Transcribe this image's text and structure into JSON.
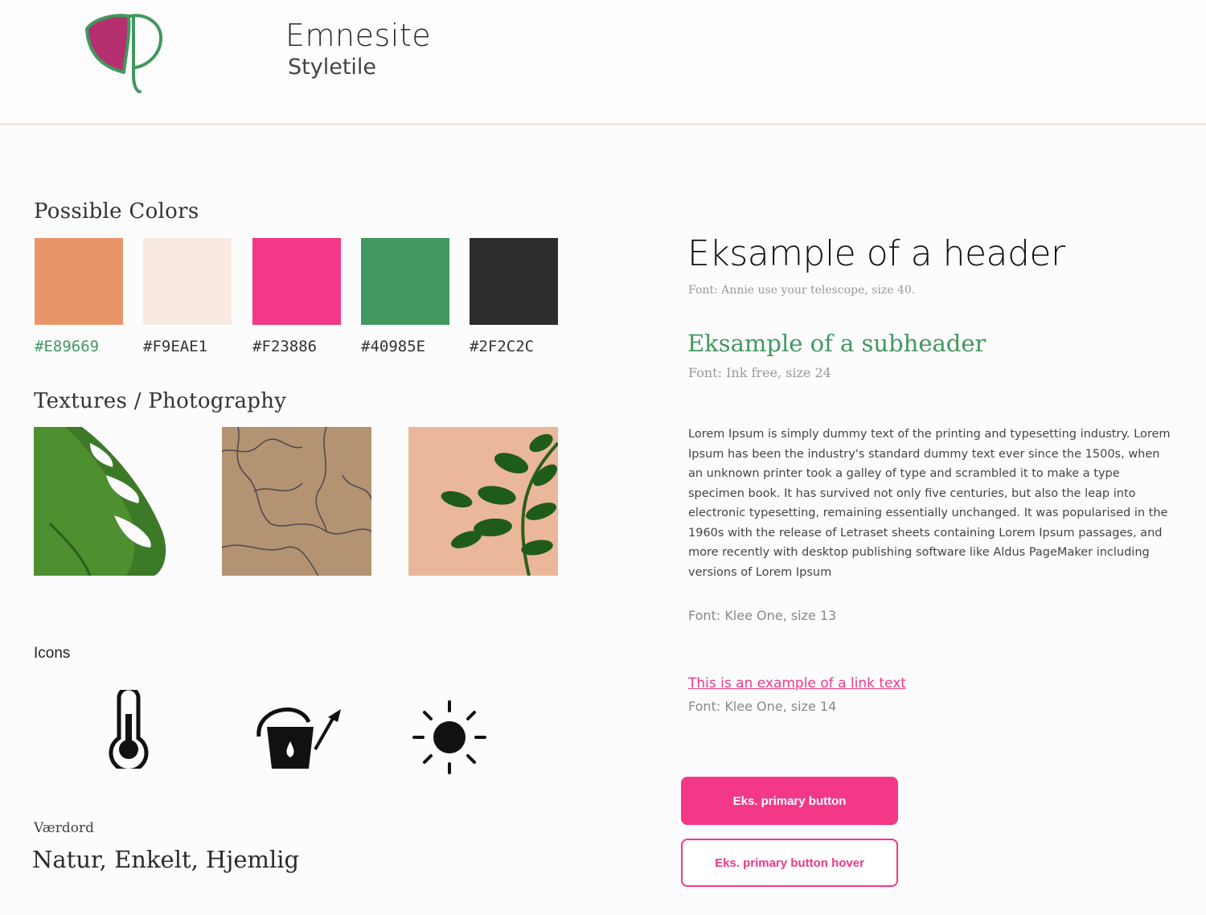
{
  "header": {
    "title": "Emnesite",
    "subtitle": "Styletile"
  },
  "colors": {
    "section_title": "Possible Colors",
    "swatches": [
      {
        "hex": "#E89669",
        "label": "#E89669",
        "label_color": "#40985E"
      },
      {
        "hex": "#F9EAE1",
        "label": "#F9EAE1",
        "label_color": "#2F2C2C"
      },
      {
        "hex": "#F23886",
        "label": "#F23886",
        "label_color": "#2F2C2C"
      },
      {
        "hex": "#40985E",
        "label": "#40985E",
        "label_color": "#2F2C2C"
      },
      {
        "hex": "#2F2C2C",
        "label": "#2F2C2C",
        "label_color": "#2F2C2C"
      }
    ]
  },
  "textures": {
    "section_title": "Textures / Photography",
    "images": [
      "monstera-leaf-photo",
      "cracked-earth-photo",
      "zz-plant-on-peach-photo"
    ]
  },
  "icons": {
    "section_title": "Icons",
    "items": [
      "thermometer-icon",
      "watering-can-icon",
      "sun-icon"
    ]
  },
  "values": {
    "label": "Værdord",
    "text": "Natur, Enkelt, Hjemlig"
  },
  "typography": {
    "header": "Eksample of a header",
    "header_note": "Font: Annie use your telescope, size 40.",
    "subheader": "Eksample of a subheader",
    "subheader_note": "Font: Ink free, size 24",
    "body": "Lorem Ipsum is simply dummy text of the printing and typesetting industry. Lorem Ipsum has been the industry's standard dummy text ever since the 1500s, when an unknown printer took a galley of type and scrambled it to make a type specimen book. It has survived not only five centuries, but also the leap into electronic typesetting, remaining essentially unchanged. It was popularised in the 1960s with the release of Letraset sheets containing Lorem Ipsum passages, and more recently with desktop publishing software like Aldus PageMaker including versions of Lorem Ipsum",
    "body_note": "Font: Klee One, size 13",
    "link": "This is an example of a link text",
    "link_note": "Font: Klee One, size 14"
  },
  "buttons": {
    "primary": "Eks. primary button",
    "hover": "Eks. primary button hover"
  },
  "palette": {
    "accent": "#F23886",
    "green": "#40985E",
    "dark": "#2F2C2C"
  }
}
